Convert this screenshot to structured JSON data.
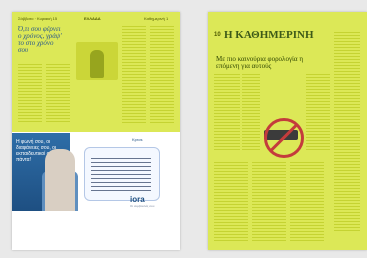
{
  "left_page": {
    "header_left": "Σάββατο · Κυριακή 15",
    "header_center": "ΕΛΛΑΔΑ",
    "header_right": "Καθημερινή 1",
    "headline": "Ό,τι σου φέρνει ο χρόνος, γράψ' το στο χρόνο σου",
    "ad": {
      "brand_top": "Kpros",
      "headline": "Η φωνή σου, οι διαφάνειες σου, οι εκπαιδευτικοί σου στα πάντα!",
      "brand_bottom": "iora",
      "brand_sub": "Οι συμβουλές σου"
    }
  },
  "right_page": {
    "masthead": "Η ΚΑΘΗΜΕΡΙΝΗ",
    "top_left_tag": "10",
    "headline": "Με πιο καινούρια φορολογία η επόμενη για αυτούς"
  },
  "colors": {
    "highlight": "#d8e645",
    "ad_blue": "#1e4f82",
    "masthead": "#3d5a18"
  }
}
